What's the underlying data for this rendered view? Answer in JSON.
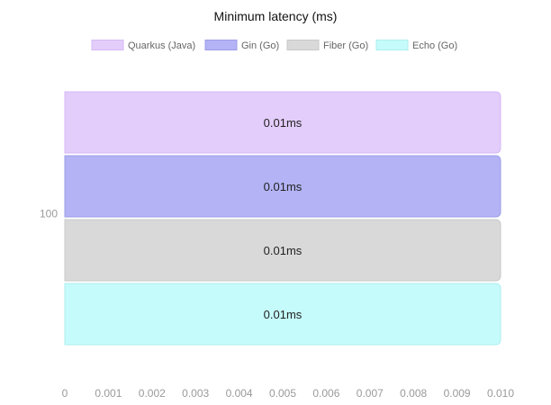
{
  "chart_data": {
    "type": "bar",
    "orientation": "horizontal",
    "title": "Minimum latency (ms)",
    "categories": [
      "100"
    ],
    "series": [
      {
        "name": "Quarkus (Java)",
        "values": [
          0.01
        ],
        "label": "0.01ms",
        "fill": "#e3cdfb",
        "stroke": "#d4b8f5"
      },
      {
        "name": "Gin (Go)",
        "values": [
          0.01
        ],
        "label": "0.01ms",
        "fill": "#b3b3f5",
        "stroke": "#9d9de8"
      },
      {
        "name": "Fiber (Go)",
        "values": [
          0.01
        ],
        "label": "0.01ms",
        "fill": "#d9d9d9",
        "stroke": "#c9c9c9"
      },
      {
        "name": "Echo (Go)",
        "values": [
          0.01
        ],
        "label": "0.01ms",
        "fill": "#c6fbfb",
        "stroke": "#aeeeee"
      }
    ],
    "xlim": [
      0,
      0.01
    ],
    "x_ticks": [
      "0",
      "0.001",
      "0.002",
      "0.003",
      "0.004",
      "0.005",
      "0.006",
      "0.007",
      "0.008",
      "0.009",
      "0.010"
    ],
    "legend_position": "top",
    "grid": false
  }
}
